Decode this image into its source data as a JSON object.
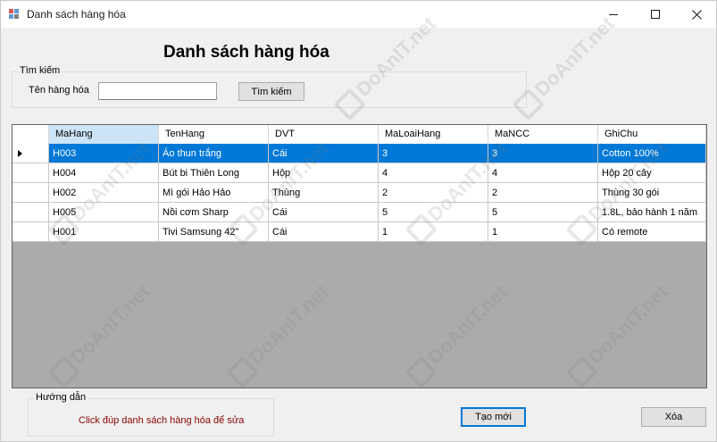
{
  "window": {
    "title": "Danh sách hàng hóa",
    "heading": "Danh sách hàng hóa"
  },
  "search": {
    "group_label": "Tìm kiếm",
    "name_label": "Tên hàng hóa",
    "name_value": "",
    "button_label": "Tìm kiếm"
  },
  "grid": {
    "columns": [
      "MaHang",
      "TenHang",
      "DVT",
      "MaLoaiHang",
      "MaNCC",
      "GhiChu"
    ],
    "selected_row": 0,
    "rows": [
      [
        "H003",
        "Áo thun trắng",
        "Cái",
        "3",
        "3",
        "Cotton 100%"
      ],
      [
        "H004",
        "Bút bi Thiên Long",
        "Hộp",
        "4",
        "4",
        "Hộp 20 cây"
      ],
      [
        "H002",
        "Mì gói Hảo Hảo",
        "Thùng",
        "2",
        "2",
        "Thùng 30 gói"
      ],
      [
        "H005",
        "Nồi cơm Sharp",
        "Cái",
        "5",
        "5",
        "1.8L, bảo hành 1 năm"
      ],
      [
        "H001",
        "Tivi Samsung 42\"",
        "Cái",
        "1",
        "1",
        "Có remote"
      ]
    ]
  },
  "help": {
    "group_label": "Hướng dẫn",
    "text": "Click đúp danh sách hàng hóa để sửa"
  },
  "actions": {
    "new_label": "Tạo mới",
    "delete_label": "Xóa"
  },
  "watermark": "DoAnIT.net",
  "colors": {
    "selection": "#0078d7",
    "help_text": "#8b0000",
    "selected_header": "#cce4f7"
  }
}
